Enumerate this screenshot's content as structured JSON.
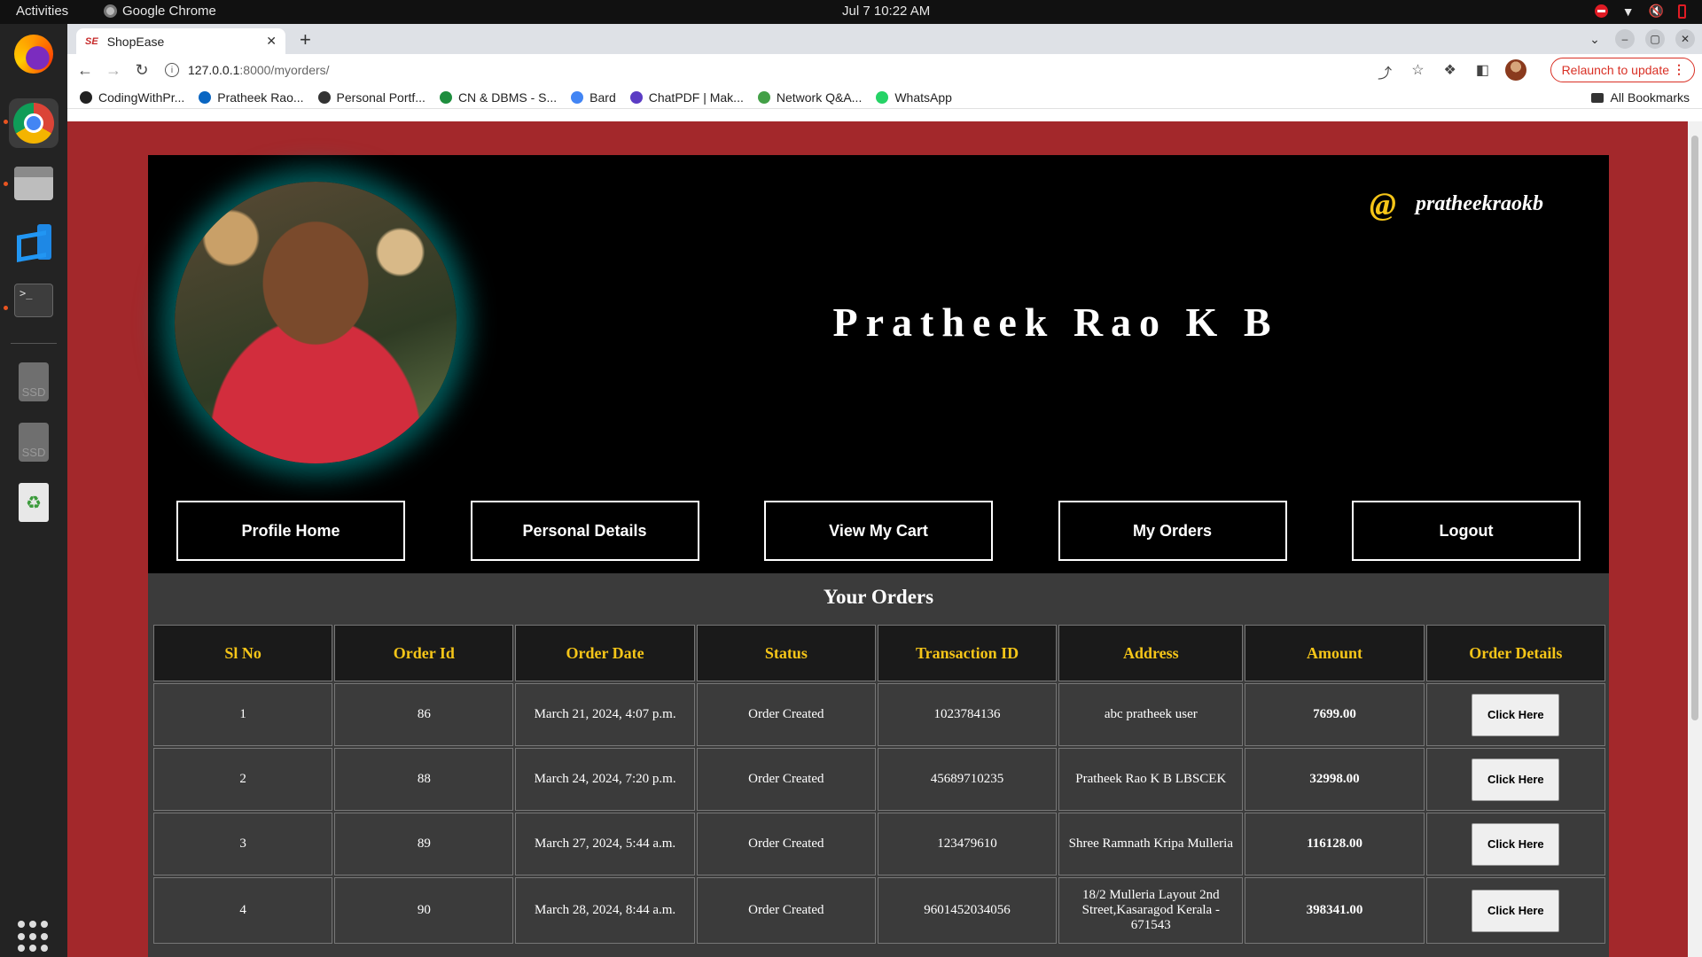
{
  "system": {
    "activities": "Activities",
    "app_name": "Google Chrome",
    "clock": "Jul 7  10:22 AM"
  },
  "browser": {
    "tab_title": "ShopEase",
    "tab_favicon": "SE",
    "url_host": "127.0.0.1",
    "url_path": ":8000/myorders/",
    "relaunch_label": "Relaunch to update",
    "bookmarks": [
      {
        "label": "CodingWithPr...",
        "icon": "github-icon",
        "color": "#222222"
      },
      {
        "label": "Pratheek Rao...",
        "icon": "linkedin-icon",
        "color": "#0a66c2"
      },
      {
        "label": "Personal Portf...",
        "icon": "globe-icon",
        "color": "#333333"
      },
      {
        "label": "CN & DBMS - S...",
        "icon": "classroom-icon",
        "color": "#1e8e3e"
      },
      {
        "label": "Bard",
        "icon": "bard-icon",
        "color": "#4285f4"
      },
      {
        "label": "ChatPDF | Mak...",
        "icon": "chatpdf-icon",
        "color": "#5b3cc4"
      },
      {
        "label": "Network Q&A...",
        "icon": "network-icon",
        "color": "#43a047"
      },
      {
        "label": "WhatsApp",
        "icon": "whatsapp-icon",
        "color": "#25d366"
      }
    ],
    "all_bookmarks": "All Bookmarks"
  },
  "profile": {
    "username_symbol": "@",
    "username": "pratheekraokb",
    "full_name": "Pratheek Rao K B",
    "nav": [
      "Profile Home",
      "Personal Details",
      "View My Cart",
      "My Orders",
      "Logout"
    ]
  },
  "orders": {
    "title": "Your Orders",
    "columns": [
      "Sl No",
      "Order Id",
      "Order Date",
      "Status",
      "Transaction ID",
      "Address",
      "Amount",
      "Order Details"
    ],
    "button_label": "Click Here",
    "rows": [
      {
        "sl": "1",
        "id": "86",
        "date": "March 21, 2024, 4:07 p.m.",
        "status": "Order Created",
        "txn": "1023784136",
        "address": "abc pratheek user",
        "amount": "7699.00"
      },
      {
        "sl": "2",
        "id": "88",
        "date": "March 24, 2024, 7:20 p.m.",
        "status": "Order Created",
        "txn": "45689710235",
        "address": "Pratheek Rao K B LBSCEK",
        "amount": "32998.00"
      },
      {
        "sl": "3",
        "id": "89",
        "date": "March 27, 2024, 5:44 a.m.",
        "status": "Order Created",
        "txn": "123479610",
        "address": "Shree Ramnath Kripa Mulleria",
        "amount": "116128.00"
      },
      {
        "sl": "4",
        "id": "90",
        "date": "March 28, 2024, 8:44 a.m.",
        "status": "Order Created",
        "txn": "9601452034056",
        "address": "18/2 Mulleria Layout 2nd Street,Kasaragod Kerala - 671543",
        "amount": "398341.00"
      }
    ]
  },
  "colors": {
    "page_bg": "#a3282b",
    "header_accent": "#f5c518",
    "photo_glow": "#00aaaa"
  }
}
